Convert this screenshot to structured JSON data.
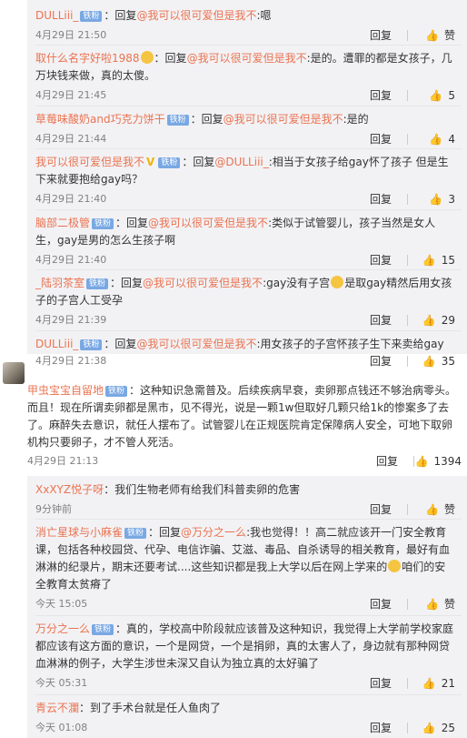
{
  "sub_replies_top": [
    {
      "user": "DULLiii_",
      "badge": "铁粉",
      "reply_prefix": "：回复",
      "mention": "@我可以很可爱但是我不",
      "text": ":嗯",
      "time": "4月29日 21:50",
      "reply_label": "回复",
      "like_label": "赞",
      "likes": ""
    },
    {
      "user": "取什么名字好啦1988",
      "badge": "",
      "reply_prefix": "：回复",
      "mention": "@我可以很可爱但是我不",
      "text": ":是的。遭罪的都是女孩子，几万块钱来做，真的太傻。",
      "time": "4月29日 21:45",
      "reply_label": "回复",
      "like_label": "",
      "likes": "5"
    },
    {
      "user": "草莓味酸奶and巧克力饼干",
      "badge": "铁粉",
      "reply_prefix": "：回复",
      "mention": "@我可以很可爱但是我不",
      "text": ":是的",
      "time": "4月29日 21:44",
      "reply_label": "回复",
      "like_label": "",
      "likes": "4"
    },
    {
      "user": "我可以很可爱但是我不",
      "badge": "铁粉",
      "reply_prefix": "：回复",
      "mention": "@DULLiii_",
      "text": ":相当于女孩子给gay怀了孩子 但是生下来就要抱给gay吗？",
      "time": "4月29日 21:40",
      "reply_label": "回复",
      "like_label": "",
      "likes": "3"
    },
    {
      "user": "脑部二极管",
      "badge": "铁粉",
      "reply_prefix": "：回复",
      "mention": "@我可以很可爱但是我不",
      "text": ":类似于试管婴儿，孩子当然是女人生，gay是男的怎么生孩子啊",
      "time": "4月29日 21:40",
      "reply_label": "回复",
      "like_label": "",
      "likes": "15"
    },
    {
      "user": "_陆羽茶室",
      "badge": "铁粉",
      "reply_prefix": "：回复",
      "mention": "@我可以很可爱但是我不",
      "text": ":gay没有子宫",
      "text2": "是取gay精然后用女孩子的子宫人工受孕",
      "time": "4月29日 21:39",
      "reply_label": "回复",
      "like_label": "",
      "likes": "29"
    },
    {
      "user": "DULLiii_",
      "badge": "铁粉",
      "reply_prefix": "：回复",
      "mention": "@我可以很可爱但是我不",
      "text": ":用女孩子的子宫怀孩子生下来卖给gay",
      "time": "4月29日 21:38",
      "reply_label": "回复",
      "like_label": "",
      "likes": "35"
    }
  ],
  "main_comment": {
    "user": "甲虫宝宝自留地",
    "badge": "铁粉",
    "text": "：这种知识急需普及。后续疾病早衰，卖卵那点钱还不够治病零头。而且！现在所谓卖卵都是黑市，见不得光，说是一颗1w但取好几颗只给1k的惨案多了去了。麻醉失去意识，就任人摆布了。试管婴儿在正规医院肯定保障病人安全，可地下取卵机构只要卵子，才不管人死活。",
    "time": "4月29日 21:13",
    "reply_label": "回复",
    "likes": "1394"
  },
  "sub_replies_bottom": [
    {
      "user": "XxXYZ悦子呀",
      "badge": "",
      "text": "：我们生物老师有给我们科普卖卵的危害",
      "time": "9分钟前",
      "reply_label": "回复",
      "like_label": "赞",
      "likes": ""
    },
    {
      "user": "消亡星球与小麻雀",
      "badge": "铁粉",
      "reply_prefix": "：回复",
      "mention": "@万分之一么",
      "text": ":我也觉得！！高二就应该开一门安全教育课，包括各种校园贷、代孕、电信诈骗、艾滋、毒品、自杀诱导的相关教育，最好有血淋淋的纪录片，期末还要考试....这些知识都是我上大学以后在网上学来的",
      "text2": "咱们的安全教育太贫瘠了",
      "time": "今天 15:05",
      "reply_label": "回复",
      "like_label": "赞",
      "likes": ""
    },
    {
      "user": "万分之一么",
      "badge": "铁粉",
      "text": "：真的，学校高中阶段就应该普及这种知识，我觉得上大学前学校家庭都应该有这方面的意识，一个是网贷，一个是捐卵，真的太害人了，身边就有那种网贷血淋淋的例子，大学生涉世未深又自认为独立真的太好骗了",
      "time": "今天 05:31",
      "reply_label": "回复",
      "like_label": "",
      "likes": "21"
    },
    {
      "user": "青云不瀾",
      "badge": "",
      "text": "：到了手术台就是任人鱼肉了",
      "time": "今天 01:08",
      "reply_label": "回复",
      "like_label": "",
      "likes": "25"
    }
  ],
  "colors": {
    "username": "#eb7350",
    "panel_bg": "#f2f2f5",
    "badge_bg": "#79a8e3"
  },
  "icons": {
    "like": "thumbs-up-icon",
    "badge": "fan-badge-icon"
  }
}
